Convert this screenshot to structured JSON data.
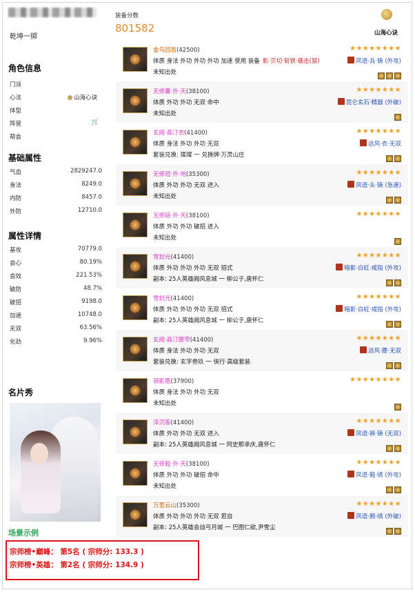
{
  "profile": {
    "name_blurred": "",
    "sub_name": "乾坤一掷"
  },
  "role_info": {
    "title": "角色信息",
    "rows": [
      {
        "label": "门派",
        "value": ""
      },
      {
        "label": "心法",
        "value": "山海心诀"
      },
      {
        "label": "体型",
        "value": ""
      },
      {
        "label": "阵营",
        "value": ""
      },
      {
        "label": "帮会",
        "value": ""
      }
    ]
  },
  "basic_attr": {
    "title": "基础属性",
    "rows": [
      {
        "label": "气血",
        "value": "2829247.0"
      },
      {
        "label": "身法",
        "value": "8249.0"
      },
      {
        "label": "内防",
        "value": "8457.0"
      },
      {
        "label": "外防",
        "value": "12710.0"
      }
    ]
  },
  "attr_detail": {
    "title": "属性详情",
    "rows": [
      {
        "label": "基攻",
        "value": "70779.0"
      },
      {
        "label": "会心",
        "value": "80.19%"
      },
      {
        "label": "会效",
        "value": "221.53%"
      },
      {
        "label": "破防",
        "value": "48.7%"
      },
      {
        "label": "破招",
        "value": "9198.0"
      },
      {
        "label": "加速",
        "value": "10748.0"
      },
      {
        "label": "无双",
        "value": "63.56%"
      },
      {
        "label": "化劲",
        "value": "9.96%"
      }
    ]
  },
  "card": {
    "title": "名片秀",
    "caption": "场景示例"
  },
  "ranks": [
    "宗师榜•巅峰：   第5名 ( 宗师分: 133.3 )",
    "宗师榜•英雄：   第2名 ( 宗师分: 134.9 )"
  ],
  "header": {
    "score_label": "装备分数",
    "score_value": "801582",
    "xinjue": "山海心诀"
  },
  "equips": [
    {
      "name": "金乌回首",
      "score": "(42500)",
      "pink": false,
      "attrs": "体质 身法 外功 外功 外功 加速   使用 装备",
      "gem_inline": "影·贝切·斩铁·痛击(狼)",
      "gem": "风语·兵·铸 (外攻)",
      "source": "未知出处",
      "stars": 8,
      "slots": 3
    },
    {
      "name": "无修囊·外·天",
      "score": "(38100)",
      "pink": true,
      "attrs": "体质 外功 外功 无双 命中",
      "gem": "昆仑玄石·精器 (外破)",
      "source": "未知出处",
      "stars": 7,
      "slots": 1
    },
    {
      "name": "玄阙·森汀衣",
      "score": "(41400)",
      "pink": true,
      "attrs": "体质 身法 外功 外功 无双",
      "gem": "远风·衣·无双",
      "source": "套装兑换: 璨璨 一 兑换牌·万灵山庄",
      "stars": 7,
      "slots": 2
    },
    {
      "name": "无修冠·外·地",
      "score": "(35300)",
      "pink": true,
      "attrs": "体质 外功 外功 无双 进入",
      "gem": "风语·头·铸 (急速)",
      "source": "未知出处",
      "stars": 7,
      "slots": 2
    },
    {
      "name": "无修链·外·天",
      "score": "(38100)",
      "pink": true,
      "attrs": "体质 外功 外功 破招 进入",
      "gem": "",
      "source": "未知出处",
      "stars": 7,
      "slots": 1
    },
    {
      "name": "雪封光",
      "score": "(41400)",
      "pink": true,
      "attrs": "体质 外功 外功 外功 无双 招式",
      "gem": "暗影·白虹·戒指 (外攻)",
      "source": "副本: 25人英雄阙风息城 一 柳公子,唐怀仁",
      "stars": 7,
      "slots": 2
    },
    {
      "name": "雪封光",
      "score": "(41400)",
      "pink": true,
      "attrs": "体质 外功 外功 外功 无双 招式",
      "gem": "暗影·白虹·戒指 (外攻)",
      "source": "副本: 25人英雄阙风息城 一 柳公子,唐怀仁",
      "stars": 7,
      "slots": 2
    },
    {
      "name": "玄阙·森汀腰带",
      "score": "(41400)",
      "pink": true,
      "attrs": "体质 身法 外功 外功 无双",
      "gem": "远风·腰·无双",
      "source": "套装兑换: 玄字叁玖 一 侠行·高级套装",
      "stars": 7,
      "slots": 2
    },
    {
      "name": "骑影凰",
      "score": "(37900)",
      "pink": true,
      "attrs": "体质 身法 外功 外功 无双",
      "gem": "",
      "source": "未知出处",
      "stars": 8,
      "slots": 1
    },
    {
      "name": "淳沉客",
      "score": "(41400)",
      "pink": true,
      "attrs": "体质 外功 外功 无双 进入",
      "gem": "风语·裤·铸 (无双)",
      "source": "副本: 25人英雄阙风息城 一 阿史那承庆,唐怀仁",
      "stars": 7,
      "slots": 2
    },
    {
      "name": "无修鞋·外·天",
      "score": "(38100)",
      "pink": true,
      "attrs": "体质 外功 外功 破招 命中",
      "gem": "风语·鞋·绣 (外攻)",
      "source": "未知出处",
      "stars": 7,
      "slots": 2
    },
    {
      "name": "万里云山",
      "score": "(35300)",
      "pink": false,
      "attrs": "体质 外功 外功 外功 无双 若自",
      "gem": "风语·腕·绣 (外破)",
      "source": "副本: 25人英雄会战弓月城 一 巴图仁欲,尹雪尘",
      "stars": 7,
      "slots": 2
    }
  ],
  "colors": {
    "accent": "#e38b28",
    "pink": "#e040c8",
    "red": "#e01414",
    "green": "#2fa65a",
    "gem_blue": "#2a55b8"
  }
}
